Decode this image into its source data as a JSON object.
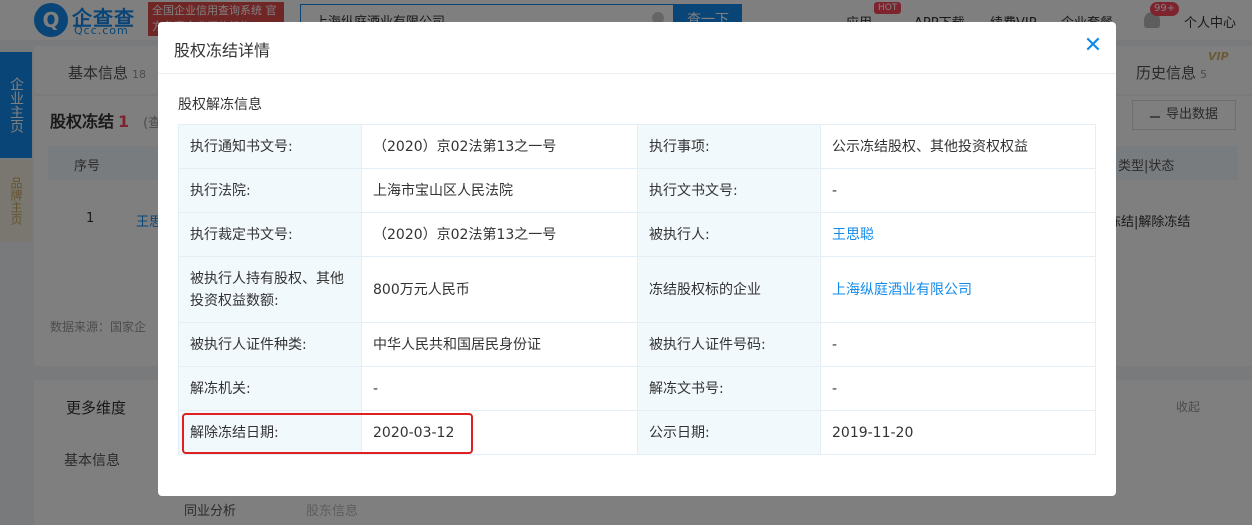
{
  "header": {
    "logo_text": "企查查",
    "logo_sub": "Qcc.com",
    "slogan": "全国企业信用查询系统 官方备案企业征信机构",
    "search_value": "上海纵庭酒业有限公司",
    "search_button": "查一下",
    "nav": [
      "应用",
      "APP下载",
      "续费VIP",
      "企业套餐"
    ],
    "hot_badge": "HOT",
    "message_badge": "99+",
    "user": "个人中心"
  },
  "side_tabs": {
    "main": "企业主页",
    "brand": "品牌主页"
  },
  "background": {
    "tab_basic": "基本信息",
    "tab_basic_count": "18",
    "tab_history": "历史信息",
    "tab_history_count": "5",
    "vip": "VIP",
    "section_title": "股权冻结",
    "section_count": "1",
    "section_hint": "(查",
    "export_label": "导出数据",
    "col_index": "序号",
    "col_type": "类型|状态",
    "row_index": "1",
    "row_name": "王思",
    "row_type": "冻结|解除冻结",
    "source": "数据来源：国家企",
    "more_title": "更多维度",
    "collapse": "收起",
    "more_basic": "基本信息",
    "more_industry": "同业分析",
    "more_sub": "股东信息"
  },
  "modal": {
    "title": "股权冻结详情",
    "section": "股权解冻信息",
    "rows": [
      {
        "l1": "执行通知书文号:",
        "v1": "（2020）京02法第13之一号",
        "l2": "执行事项:",
        "v2": "公示冻结股权、其他投资权权益"
      },
      {
        "l1": "执行法院:",
        "v1": "上海市宝山区人民法院",
        "l2": "执行文书文号:",
        "v2": "-"
      },
      {
        "l1": "执行裁定书文号:",
        "v1": "（2020）京02法第13之一号",
        "l2": "被执行人:",
        "v2": "王思聪"
      },
      {
        "l1": "被执行人持有股权、其他投资权益数额:",
        "v1": "800万元人民币",
        "l2": "冻结股权标的企业",
        "v2": "上海纵庭酒业有限公司"
      },
      {
        "l1": "被执行人证件种类:",
        "v1": "中华人民共和国居民身份证",
        "l2": "被执行人证件号码:",
        "v2": "-"
      },
      {
        "l1": "解冻机关:",
        "v1": "-",
        "l2": "解冻文书号:",
        "v2": "-"
      },
      {
        "l1": "解除冻结日期:",
        "v1": "2020-03-12",
        "l2": "公示日期:",
        "v2": "2019-11-20"
      }
    ]
  },
  "colors": {
    "accent": "#128bed",
    "highlight": "#e02020",
    "label_bg": "#f2f9fc"
  }
}
